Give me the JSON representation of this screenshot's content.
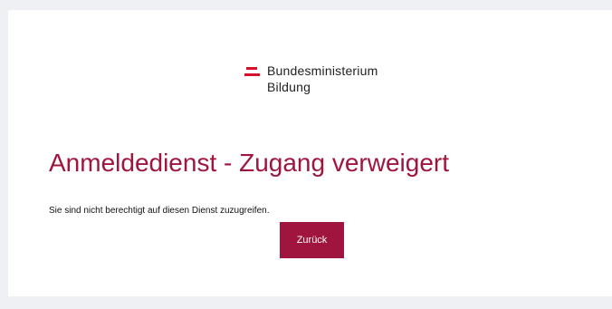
{
  "brand": {
    "line1": "Bundesministerium",
    "line2": "Bildung",
    "flag_color": "#d6102a"
  },
  "main": {
    "title": "Anmeldedienst - Zugang verweigert",
    "message": "Sie sind nicht berechtigt auf diesen Dienst zuzugreifen.",
    "back_button_label": "Zurück"
  },
  "colors": {
    "accent": "#a0153e",
    "background": "#eef0f3",
    "card": "#ffffff"
  }
}
